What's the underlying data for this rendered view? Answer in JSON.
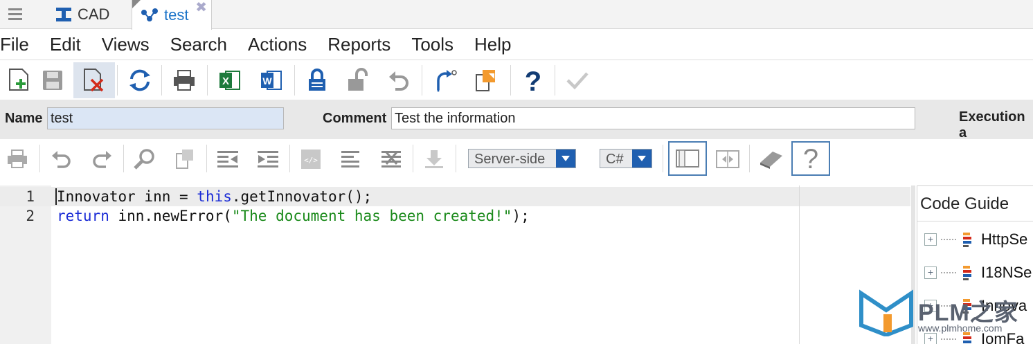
{
  "tabs": [
    {
      "label": "CAD",
      "icon": "cad-icon"
    },
    {
      "label": "test",
      "icon": "method-icon",
      "close": "✖"
    }
  ],
  "menu": [
    "File",
    "Edit",
    "Views",
    "Search",
    "Actions",
    "Reports",
    "Tools",
    "Help"
  ],
  "toolbar": {
    "buttons": [
      "new",
      "save",
      "discard",
      "refresh",
      "print",
      "export-excel",
      "export-word",
      "lock",
      "unlock",
      "undo",
      "promote",
      "copy",
      "help",
      "done"
    ]
  },
  "properties": {
    "name_label": "Name",
    "name_value": "test",
    "comment_label": "Comment",
    "comment_value": "Test the information",
    "execution_label": "Execution a"
  },
  "editor_toolbar": {
    "location": "Server-side",
    "language": "C#"
  },
  "code": {
    "lines": [
      {
        "num": "1"
      },
      {
        "num": "2"
      }
    ],
    "line1": {
      "t1": "Innovator inn = ",
      "kw": "this",
      "t2": ".getInnovator();"
    },
    "line2": {
      "kw": "return",
      "t1": " inn.newError(",
      "str": "\"The document has been created!\"",
      "t2": ");"
    }
  },
  "code_guide": {
    "title": "Code Guide",
    "items": [
      "HttpSe",
      "I18NSe",
      "Innova",
      "IomFa"
    ]
  },
  "watermark": {
    "text": "PLM之家",
    "url": "www.plmhome.com"
  },
  "colors": {
    "accent": "#1f5fb0",
    "keyword": "#1a2bd6",
    "string": "#1a8a1a",
    "active_field": "#dbe6f5"
  }
}
